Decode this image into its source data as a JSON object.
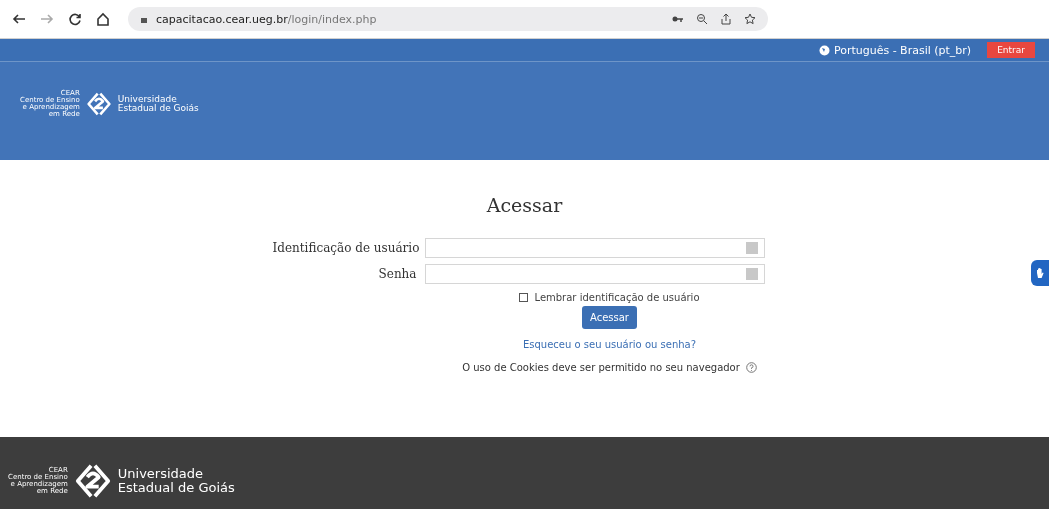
{
  "browser": {
    "url_host": "capacitacao.cear.ueg.br",
    "url_path": "/login/index.php"
  },
  "navbar": {
    "language": "Português - Brasil (pt_br)",
    "login_button": "Entrar"
  },
  "logo": {
    "cear_lines": [
      "CEAR",
      "Centro de Ensino",
      "e Aprendizagem",
      "em Rede"
    ],
    "university_lines": [
      "Universidade",
      "Estadual de Goiás"
    ]
  },
  "login": {
    "title": "Acessar",
    "fields": [
      {
        "label": "Identificação de usuário"
      },
      {
        "label": "Senha"
      }
    ],
    "remember": {
      "label": "Lembrar identificação de usuário",
      "checked": false
    },
    "submit": "Acessar",
    "forgot_link": "Esqueceu o seu usuário ou senha?",
    "cookies_notice": "O uso de Cookies deve ser permitido no seu navegador"
  },
  "footer": {
    "cear_lines": [
      "CEAR",
      "Centro de Ensino",
      "e Aprendizagem",
      "em Rede"
    ],
    "university_lines": [
      "Universidade",
      "Estadual de Goiás"
    ]
  }
}
